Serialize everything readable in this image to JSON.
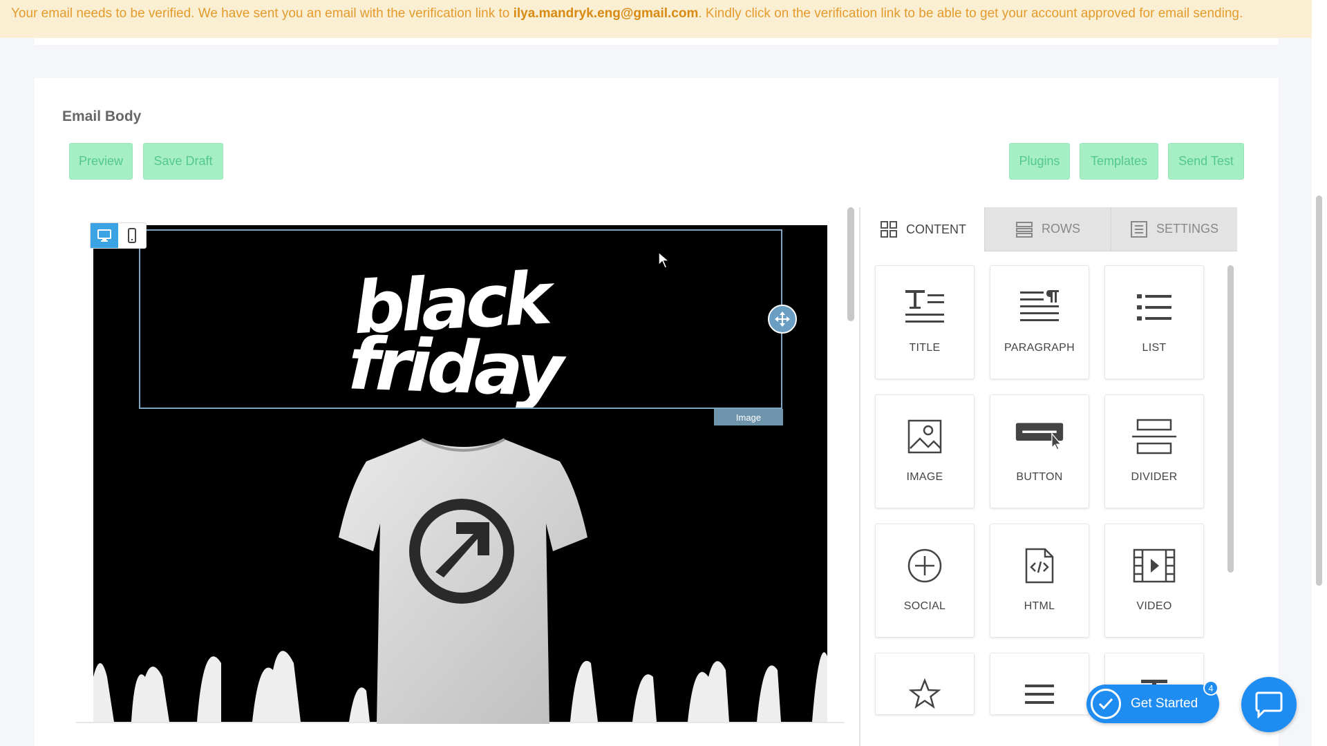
{
  "banner": {
    "text_before": "Your email needs to be verified. We have sent you an email with the verification link to ",
    "email": "ilya.mandryk.eng@gmail.com",
    "text_after": ". Kindly click on the verification link to be able to get your account approved for email sending."
  },
  "email_body": {
    "title": "Email Body",
    "left_buttons": {
      "preview": "Preview",
      "save_draft": "Save Draft"
    },
    "right_buttons": {
      "plugins": "Plugins",
      "templates": "Templates",
      "send_test": "Send Test"
    }
  },
  "editor": {
    "selected_block_tag": "Image",
    "view_modes": [
      "desktop",
      "mobile"
    ],
    "active_view": "desktop"
  },
  "panel": {
    "tabs": {
      "content": "CONTENT",
      "rows": "ROWS",
      "settings": "SETTINGS"
    },
    "active_tab": "CONTENT",
    "tiles": {
      "title": "TITLE",
      "paragraph": "PARAGRAPH",
      "list": "LIST",
      "image": "IMAGE",
      "button": "BUTTON",
      "divider": "DIVIDER",
      "social": "SOCIAL",
      "html": "HTML",
      "video": "VIDEO"
    }
  },
  "widgets": {
    "get_started": "Get Started",
    "get_started_badge": "4"
  },
  "colors": {
    "banner_bg": "#fbefd3",
    "banner_text": "#e29b2c",
    "action_button_bg": "#a6efc4",
    "action_button_text": "#52c98a",
    "accent_blue": "#1e8cf0"
  }
}
